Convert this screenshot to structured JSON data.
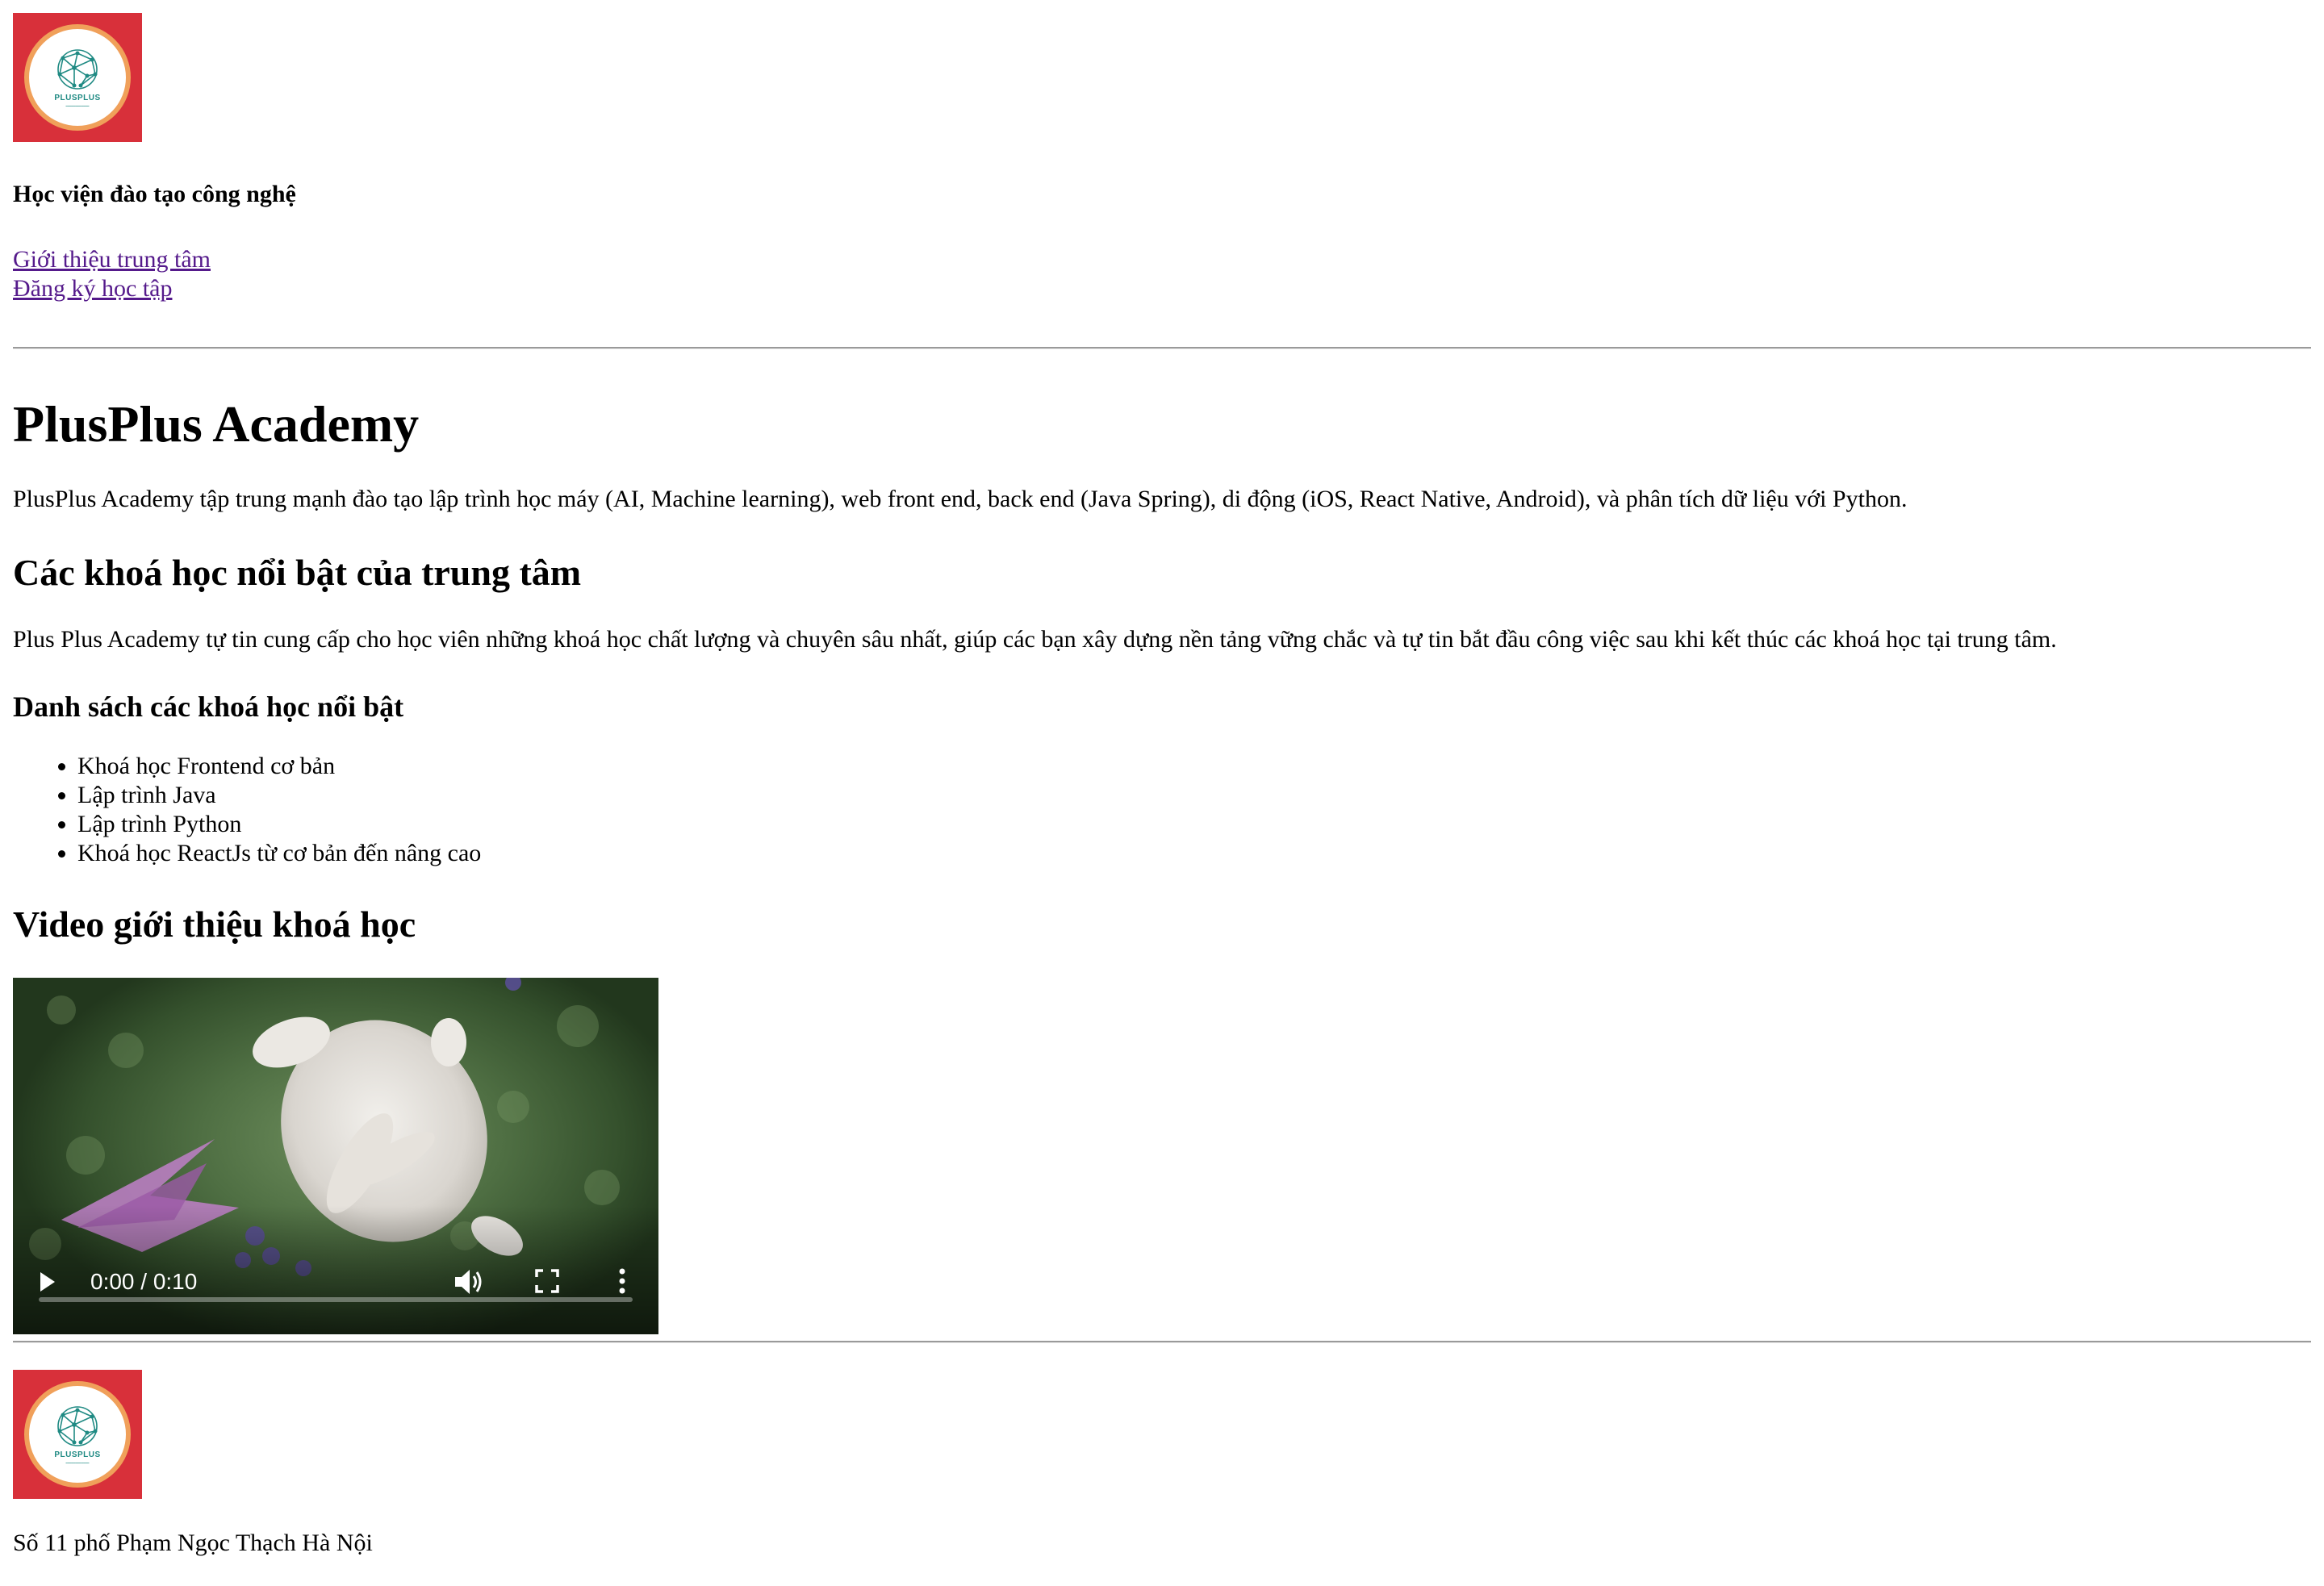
{
  "header": {
    "logo_name": "PLUSPLUS",
    "subtitle": "Học viện đào tạo công nghệ",
    "nav": [
      {
        "label": "Giới thiệu trung tâm"
      },
      {
        "label": "Đăng ký học tập"
      }
    ]
  },
  "main": {
    "title": "PlusPlus Academy",
    "intro": "PlusPlus Academy tập trung mạnh đào tạo lập trình học máy (AI, Machine learning), web front end, back end (Java Spring), di động (iOS, React Native, Android), và phân tích dữ liệu với Python.",
    "featured_heading": "Các khoá học nổi bật của trung tâm",
    "featured_text": "Plus Plus Academy tự tin cung cấp cho học viên những khoá học chất lượng và chuyên sâu nhất, giúp các bạn xây dựng nền tảng vững chắc và tự tin bắt đầu công việc sau khi kết thúc các khoá học tại trung tâm.",
    "list_heading": "Danh sách các khoá học nổi bật",
    "courses": [
      "Khoá học Frontend cơ bản",
      "Lập trình Java",
      "Lập trình Python",
      "Khoá học ReactJs từ cơ bản đến nâng cao"
    ],
    "video_heading": "Video giới thiệu khoá học",
    "video": {
      "time": "0:00 / 0:10",
      "progress": 0,
      "icons": [
        "play-icon",
        "volume-icon",
        "fullscreen-icon",
        "more-options-icon"
      ]
    }
  },
  "footer": {
    "logo_name": "PLUSPLUS",
    "address": "Số 11 phố Phạm Ngọc Thạch Hà Nội"
  },
  "colors": {
    "logo_bg": "#d8303a",
    "logo_ring": "#f0a05a",
    "logo_teal": "#1f8a83",
    "link": "#551a8b",
    "rule": "#9a9a9a"
  }
}
